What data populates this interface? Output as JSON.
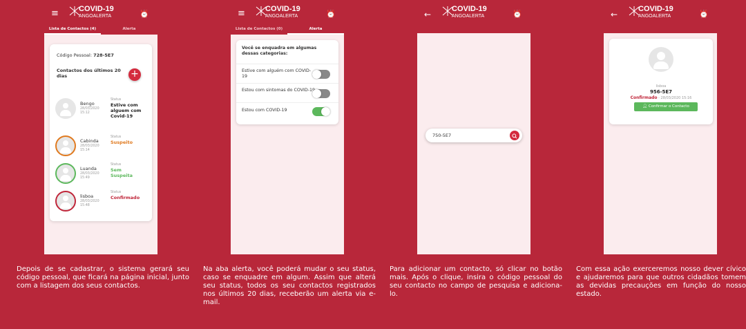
{
  "app": {
    "logo_line1": "COVID-19",
    "logo_line2": "ANGOALERTA",
    "menu_icon": "hamburger-menu-icon",
    "back_icon": "back-arrow-icon",
    "alarm_icon": "alarm-icon"
  },
  "colors": {
    "brand_red": "#b8273a",
    "button_red": "#d42b3e",
    "suspect_orange": "#e07a1f",
    "safe_green": "#5cb85c",
    "confirmed_red": "#c0263a"
  },
  "screen1": {
    "tabs": [
      "Lista de Contactos (4)",
      "Alerta"
    ],
    "code_label": "Código Pessoal:",
    "code_value": "728-5E7",
    "list_title": "Contactos dos últimos 20 dias",
    "add_label": "+",
    "status_label": "Status",
    "contacts": [
      {
        "name": "Bengo",
        "date": "28/03/2020",
        "time": "15:12",
        "status": "Estive com alguem com Covid-19"
      },
      {
        "name": "Cabinda",
        "date": "28/03/2020",
        "time": "15:14",
        "status": "Suspeito"
      },
      {
        "name": "Luanda",
        "date": "28/03/2020",
        "time": "15:49",
        "status": "Sem Suspeita"
      },
      {
        "name": "lisboa",
        "date": "28/03/2020",
        "time": "15:48",
        "status": "Confirmado"
      }
    ]
  },
  "screen2": {
    "tabs": [
      "Lista de Contactos (0)",
      "Alerta"
    ],
    "question": "Você se enquadra em algumas dessas categorias:",
    "options": [
      {
        "label": "Estive com alguém com COVID-19",
        "on": false
      },
      {
        "label": "Estou com sintomas do COVID-19",
        "on": false
      },
      {
        "label": "Estou com COVID-19",
        "on": true
      }
    ]
  },
  "screen3": {
    "search_value": "750-5E7",
    "search_icon": "search-icon"
  },
  "screen4": {
    "name": "lisboa",
    "code": "956-5E7",
    "status": "Confirmado",
    "timestamp": "- 28/03/2020 15:16",
    "confirm_label": "Confirmar o Contacto"
  },
  "captions": [
    "Depois de se cadastrar, o sistema gerará seu código pessoal, que ficará na página inicial, junto com a listagem dos seus contactos.",
    "Na aba alerta, você poderá mudar o seu status, caso se enquadre em algum. Assim que alterá seu status, todos os seu contactos registrados nos últimos 20 dias, receberão um alerta via e-mail.",
    "Para adicionar um contacto, só clicar no botão mais. Após o clique, insira o código pessoal do seu contacto no campo de pesquisa e adiciona-lo.",
    "Com essa ação exerceremos nosso dever cívico e ajudaremos para que outros cidadãos tomem as devidas precauções em função do nosso estado."
  ]
}
